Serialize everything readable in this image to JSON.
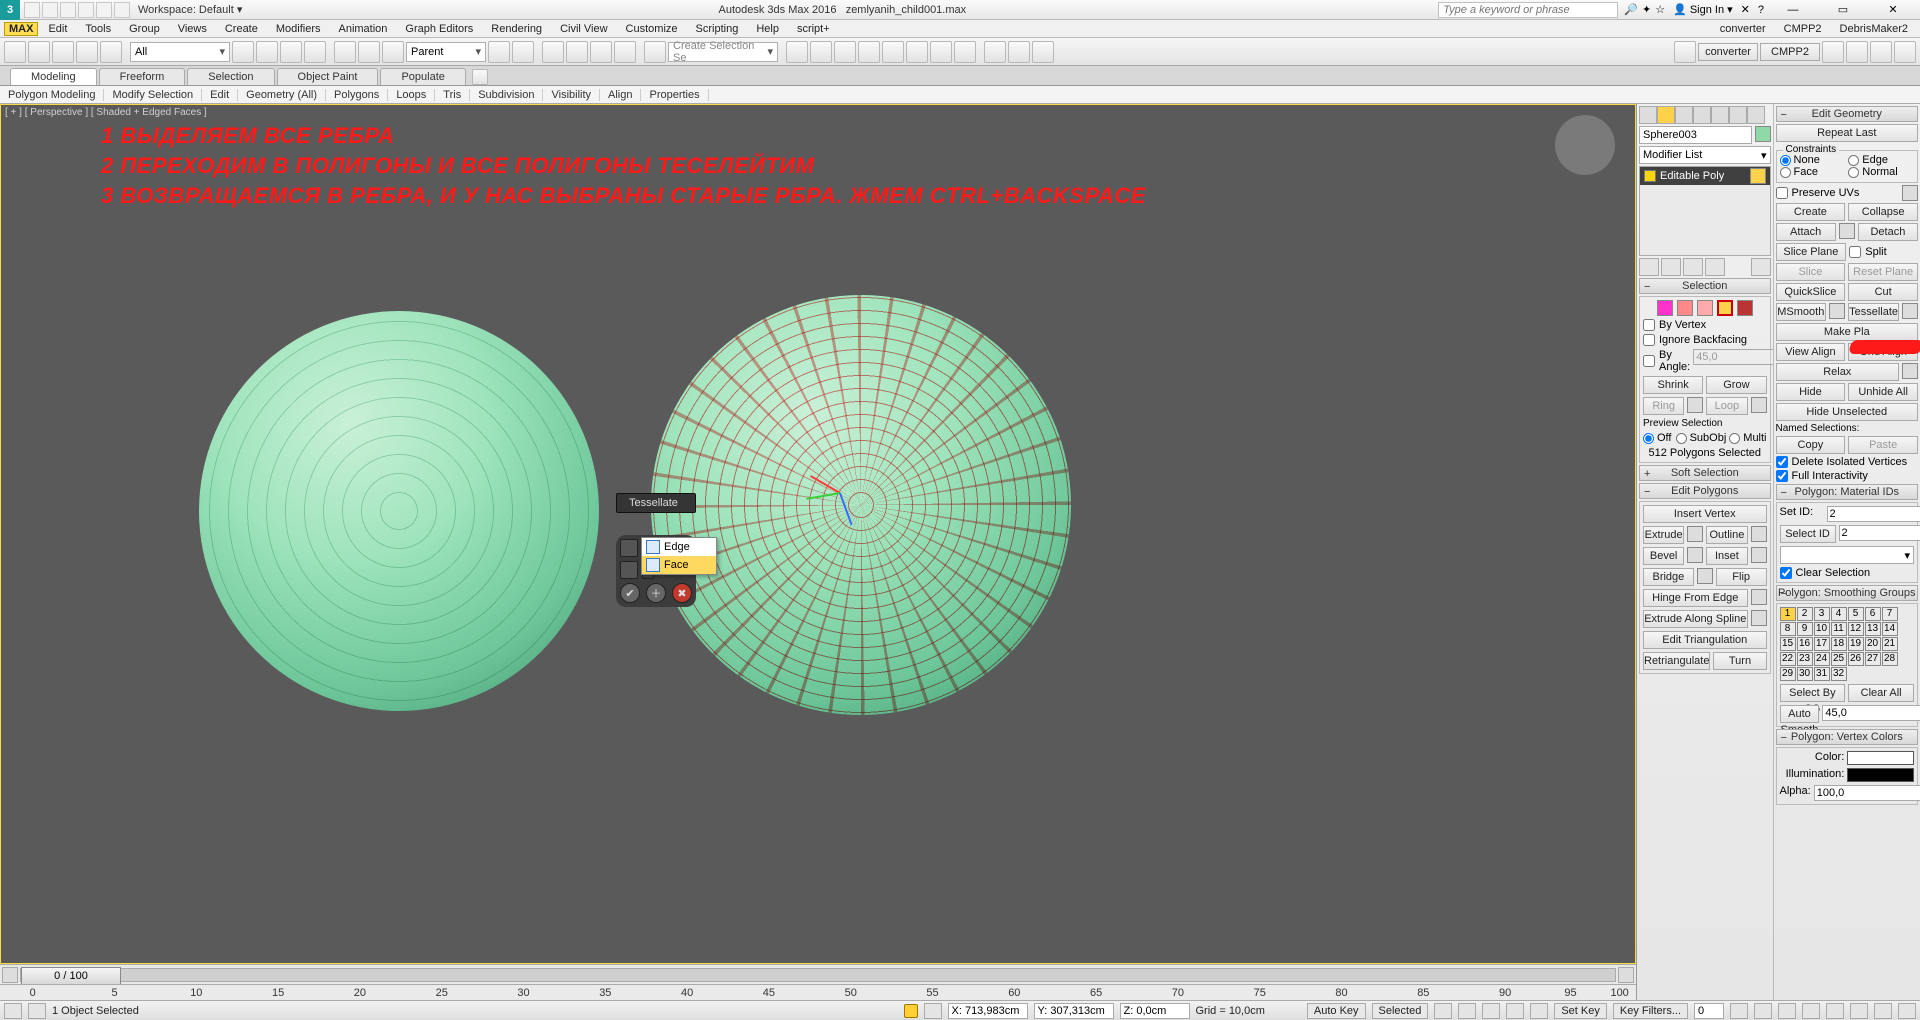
{
  "title": {
    "app": "Autodesk 3ds Max 2016",
    "file": "zemlyanih_child001.max",
    "workspace": "Workspace: Default",
    "search_placeholder": "Type a keyword or phrase",
    "signin": "Sign In"
  },
  "menu": [
    "MAX",
    "Edit",
    "Tools",
    "Group",
    "Views",
    "Create",
    "Modifiers",
    "Animation",
    "Graph Editors",
    "Rendering",
    "Civil View",
    "Customize",
    "Scripting",
    "Help",
    "script+",
    "converter",
    "CMPP2",
    "DebrisMaker2"
  ],
  "toolbar": {
    "all": "All",
    "parent": "Parent",
    "sel_set_placeholder": "Create Selection Se"
  },
  "ribbon_tabs": [
    "Modeling",
    "Freeform",
    "Selection",
    "Object Paint",
    "Populate"
  ],
  "ribbon_sub": [
    "Polygon Modeling",
    "Modify Selection",
    "Edit",
    "Geometry (All)",
    "Polygons",
    "Loops",
    "Tris",
    "Subdivision",
    "Visibility",
    "Align",
    "Properties"
  ],
  "viewport": {
    "label": "[ + ] [ Perspective ] [ Shaded + Edged Faces ]",
    "annotations": {
      "l1": "1 ВЫДЕЛЯЕМ ВСЕ РЕБРА",
      "l2": "2 ПЕРЕХОДИМ В ПОЛИГОНЫ И ВСЕ ПОЛИГОНЫ ТЕСЕЛЕЙТИМ",
      "l3": "3 ВОЗВРАЩАЕМСЯ В РЕБРА, И У НАС ВЫБРАНЫ СТАРЫЕ РБРА. ЖМЕМ CTRL+BACKSPACE"
    },
    "tess_label": "Tessellate",
    "tess_menu": {
      "edge": "Edge",
      "face": "Face"
    }
  },
  "cmdpanel": {
    "object": "Sphere003",
    "modlist": "Modifier List",
    "stack_item": "Editable Poly",
    "selection_hdr": "Selection",
    "soft_sel": "Soft Selection",
    "edit_polys": "Edit Polygons",
    "by_vertex": "By Vertex",
    "ignore_bf": "Ignore Backfacing",
    "by_angle": "By Angle:",
    "by_angle_val": "45,0",
    "shrink": "Shrink",
    "grow": "Grow",
    "ring": "Ring",
    "loop": "Loop",
    "preview": "Preview Selection",
    "off": "Off",
    "subobj": "SubObj",
    "multi": "Multi",
    "sel_count": "512 Polygons Selected",
    "insert_vertex": "Insert Vertex",
    "extrude": "Extrude",
    "outline": "Outline",
    "bevel": "Bevel",
    "inset": "Inset",
    "bridge": "Bridge",
    "flip": "Flip",
    "hinge": "Hinge From Edge",
    "extrude_spline": "Extrude Along Spline",
    "edit_tri": "Edit Triangulation",
    "retri": "Retriangulate",
    "turn": "Turn"
  },
  "editgeo": {
    "hdr": "Edit Geometry",
    "repeat": "Repeat Last",
    "constraints": "Constraints",
    "none": "None",
    "edge": "Edge",
    "face": "Face",
    "normal": "Normal",
    "preserve": "Preserve UVs",
    "create": "Create",
    "collapse": "Collapse",
    "attach": "Attach",
    "detach": "Detach",
    "slice_plane": "Slice Plane",
    "split": "Split",
    "slice": "Slice",
    "reset_plane": "Reset Plane",
    "quickslice": "QuickSlice",
    "cut": "Cut",
    "msmooth": "MSmooth",
    "tessellate": "Tessellate",
    "make_planar": "Make Pla",
    "view_align": "View Align",
    "grid_align": "Grid Align",
    "relax": "Relax",
    "hide_sel": "Hide Selected",
    "unhide": "Unhide All",
    "hide_unsel": "Hide Unselected",
    "named_sel": "Named Selections:",
    "copy": "Copy",
    "paste": "Paste",
    "del_iso": "Delete Isolated Vertices",
    "full_int": "Full Interactivity",
    "matids": "Polygon: Material IDs",
    "setid": "Set ID:",
    "selid": "Select ID",
    "id_val": "2",
    "clear_sel": "Clear Selection",
    "smg": "Polygon: Smoothing Groups",
    "sel_by_sg": "Select By SG",
    "clear_all": "Clear All",
    "auto_smooth": "Auto Smooth",
    "auto_val": "45,0",
    "vcol": "Polygon: Vertex Colors",
    "color": "Color:",
    "illum": "Illumination:",
    "alpha": "Alpha:",
    "alpha_val": "100,0"
  },
  "time": {
    "frame": "0 / 100",
    "ticks": [
      "0",
      "5",
      "10",
      "15",
      "20",
      "25",
      "30",
      "35",
      "40",
      "45",
      "50",
      "55",
      "60",
      "65",
      "70",
      "75",
      "80",
      "85",
      "90",
      "95",
      "100"
    ]
  },
  "status": {
    "sel": "1 Object Selected",
    "x": "X: 713,983cm",
    "y": "Y: 307,313cm",
    "z": "Z: 0,0cm",
    "grid": "Grid = 10,0cm",
    "autokey": "Auto Key",
    "selected": "Selected",
    "setkey": "Set Key",
    "keyfilters": "Key Filters..."
  }
}
